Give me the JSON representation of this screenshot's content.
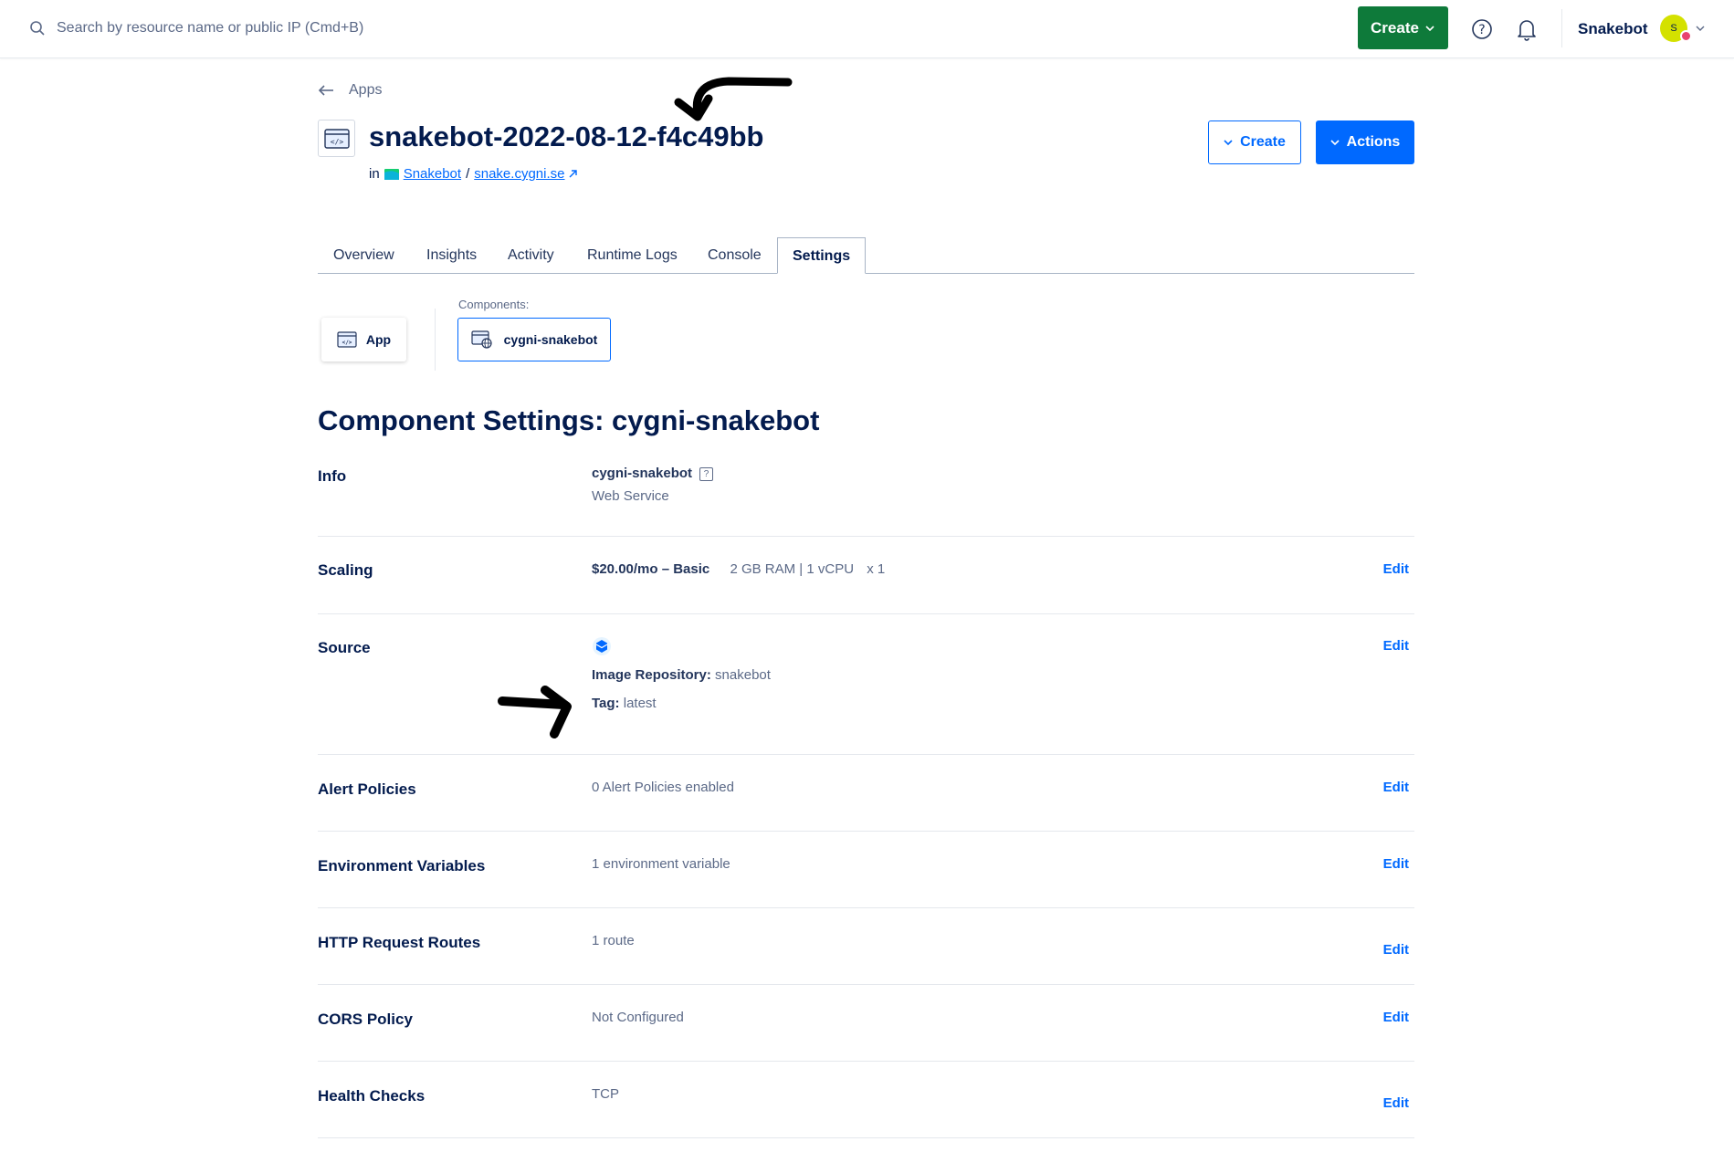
{
  "topbar": {
    "search_placeholder": "Search by resource name or public IP (Cmd+B)",
    "create_label": "Create",
    "team_name": "Snakebot",
    "avatar_initial": "S"
  },
  "breadcrumb": {
    "back_label": "Apps"
  },
  "header": {
    "app_name": "snakebot-2022-08-12-f4c49bb",
    "in_label": "in",
    "project_name": "Snakebot",
    "separator": "/",
    "domain": "snake.cygni.se",
    "create_button": "Create",
    "actions_button": "Actions"
  },
  "tabs": [
    "Overview",
    "Insights",
    "Activity",
    "Runtime Logs",
    "Console",
    "Settings"
  ],
  "active_tab": "Settings",
  "components": {
    "label": "Components:",
    "app_button": "App",
    "selected": "cygni-snakebot"
  },
  "section_title": "Component Settings: cygni-snakebot",
  "edit_label": "Edit",
  "settings": {
    "info": {
      "label": "Info",
      "name": "cygni-snakebot",
      "help": "?",
      "type": "Web Service"
    },
    "scaling": {
      "label": "Scaling",
      "price": "$20.00/mo – Basic",
      "specs": "2 GB RAM | 1 vCPU",
      "count": "x  1"
    },
    "source": {
      "label": "Source",
      "repo_key": "Image Repository:",
      "repo_value": "snakebot",
      "tag_key": "Tag:",
      "tag_value": "latest"
    },
    "alert_policies": {
      "label": "Alert Policies",
      "value": "0 Alert Policies enabled"
    },
    "env_vars": {
      "label": "Environment Variables",
      "value": "1 environment variable"
    },
    "routes": {
      "label": "HTTP Request Routes",
      "value": "1 route"
    },
    "cors": {
      "label": "CORS Policy",
      "value": "Not Configured"
    },
    "health": {
      "label": "Health Checks",
      "value": "TCP"
    }
  },
  "colors": {
    "primary": "#0069ff",
    "create_green": "#0e7a3a",
    "text": "#031b4e",
    "muted": "#5b6987"
  }
}
